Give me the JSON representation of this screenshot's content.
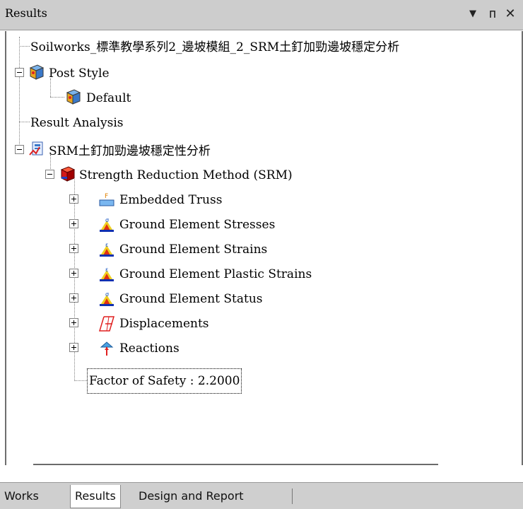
{
  "window": {
    "title": "Results",
    "dropdown_glyph": "▼",
    "pin_glyph": "ᴨ",
    "close_glyph": "✕"
  },
  "tree": {
    "root_label": "Soilworks_標準教學系列2_邊坡模組_2_SRM土釘加勁邊坡穩定分析",
    "post_style": "Post Style",
    "default": "Default",
    "result_analysis": "Result Analysis",
    "srm_group": "SRM土釘加勁邊坡穩定性分析",
    "srm_method": "Strength Reduction Method (SRM)",
    "items": [
      {
        "label": "Embedded Truss",
        "icon": "embedded-truss-icon"
      },
      {
        "label": "Ground Element Stresses",
        "icon": "stress-contour-icon"
      },
      {
        "label": "Ground Element Strains",
        "icon": "strain-contour-icon"
      },
      {
        "label": "Ground Element Plastic Strains",
        "icon": "plastic-strain-contour-icon"
      },
      {
        "label": "Ground Element Status",
        "icon": "status-contour-icon"
      },
      {
        "label": "Displacements",
        "icon": "displacement-mesh-icon"
      },
      {
        "label": "Reactions",
        "icon": "reaction-arrow-icon"
      }
    ],
    "factor_of_safety": "Factor of Safety : 2.2000"
  },
  "tabs": [
    "Works",
    "Results",
    "Design and Report"
  ],
  "colors": {
    "titlebar": "#cdcdcd",
    "tabbar": "#cfcfcf",
    "cube_red": "#d41818",
    "cube_blue": "#2040c0",
    "post_style_icon": "#3a78c8"
  }
}
